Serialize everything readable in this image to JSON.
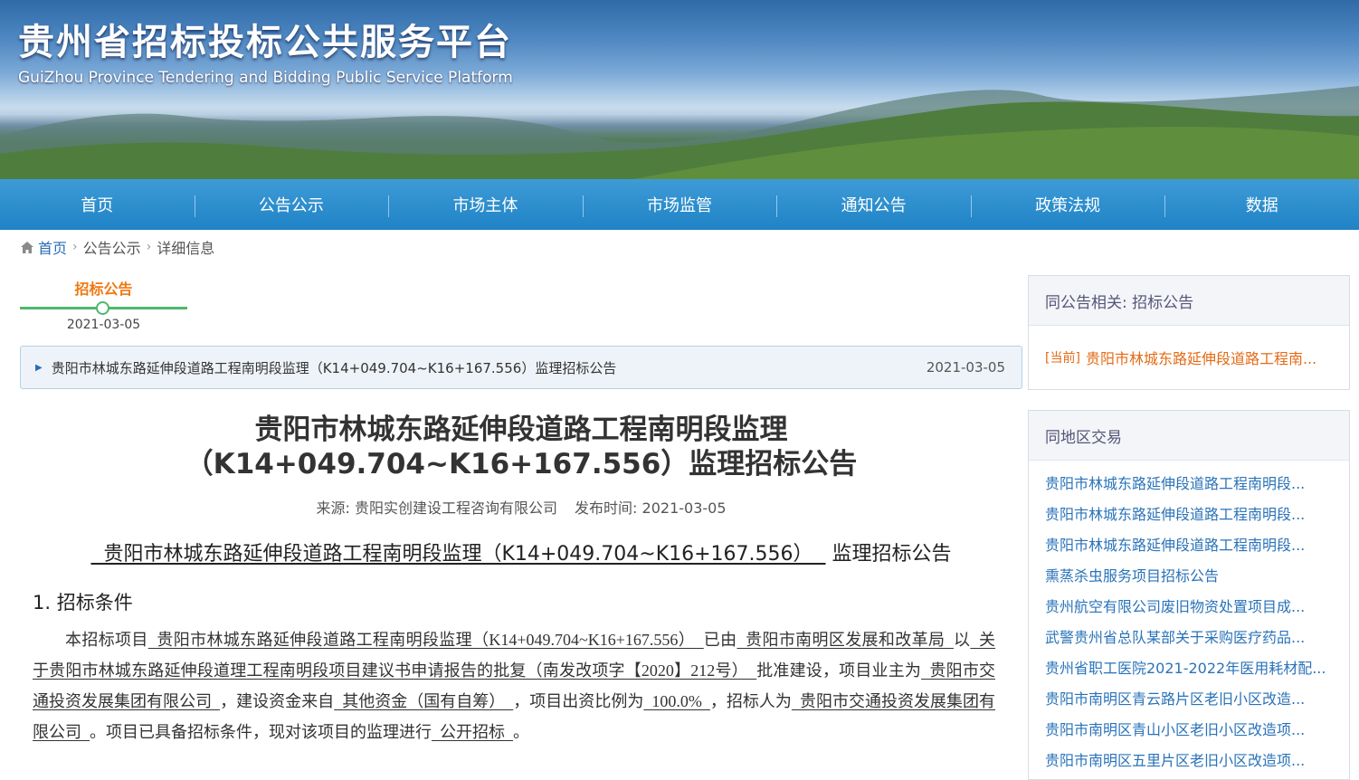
{
  "site": {
    "title": "贵州省招标投标公共服务平台",
    "subtitle": "GuiZhou Province Tendering and Bidding Public Service Platform"
  },
  "nav": [
    "首页",
    "公告公示",
    "市场主体",
    "市场监管",
    "通知公告",
    "政策法规",
    "数据"
  ],
  "breadcrumb": {
    "home": "首页",
    "level1": "公告公示",
    "level2": "详细信息",
    "separator": "›"
  },
  "timeline": {
    "label": "招标公告",
    "date": "2021-03-05"
  },
  "notice": {
    "title": "贵阳市林城东路延伸段道路工程南明段监理（K14+049.704~K16+167.556）监理招标公告",
    "date": "2021-03-05"
  },
  "article": {
    "title_line1": "贵阳市林城东路延伸段道路工程南明段监理",
    "title_line2": "（K14+049.704~K16+167.556）监理招标公告",
    "source": "来源: 贵阳实创建设工程咨询有限公司",
    "publish": "发布时间: 2021-03-05",
    "sub_title_underlined": "  贵阳市林城东路延伸段道路工程南明段监理（K14+049.704~K16+167.556）  ",
    "sub_title_rest": "监理招标公告",
    "section1": "1. 招标条件",
    "p": {
      "t1": "本招标项目",
      "u1": "  贵阳市林城东路延伸段道路工程南明段监理（K14+049.704~K16+167.556）  ",
      "t2": "已由",
      "u2": "  贵阳市南明区发展和改革局  ",
      "t3": "以",
      "u3": "  关于贵阳市林城东路延伸段道理工程南明段项目建议书申请报告的批复（南发改项字【2020】212号）  ",
      "t4": "批准建设，项目业主为",
      "u4": "  贵阳市交通投资发展集团有限公司  ",
      "t5": "，建设资金来自",
      "u5": "  其他资金（国有自筹）  ",
      "t6": "，项目出资比例为",
      "u6": "  100.0%  ",
      "t7": "，招标人为",
      "u7": "  贵阳市交通投资发展集团有限公司  ",
      "t8": "。项目已具备招标条件，现对该项目的监理进行",
      "u8": "  公开招标  ",
      "t9": "。"
    }
  },
  "related": {
    "head": "同公告相关: 招标公告",
    "tag": "[当前]",
    "item": "贵阳市林城东路延伸段道路工程南..."
  },
  "region": {
    "head": "同地区交易",
    "items": [
      "贵阳市林城东路延伸段道路工程南明段...",
      "贵阳市林城东路延伸段道路工程南明段...",
      "贵阳市林城东路延伸段道路工程南明段...",
      "熏蒸杀虫服务项目招标公告",
      "贵州航空有限公司废旧物资处置项目成...",
      "武警贵州省总队某部关于采购医疗药品...",
      "贵州省职工医院2021-2022年医用耗材配...",
      "贵阳市南明区青云路片区老旧小区改造...",
      "贵阳市南明区青山小区老旧小区改造项...",
      "贵阳市南明区五里片区老旧小区改造项..."
    ]
  },
  "colors": {
    "nav": "#1f83c6",
    "accent_orange": "#e46a14",
    "link_blue": "#2a73b8",
    "timeline_green": "#4cb86c"
  }
}
